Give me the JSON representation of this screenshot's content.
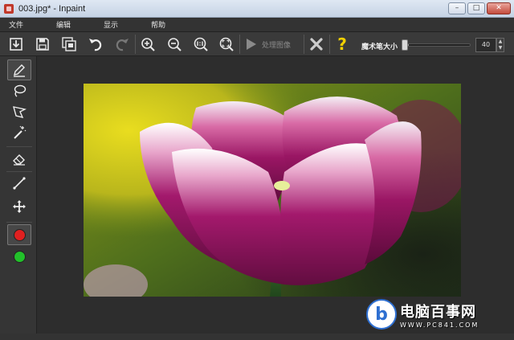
{
  "window": {
    "title": "003.jpg* - Inpaint",
    "minimize_glyph": "–",
    "maximize_glyph": "□",
    "close_glyph": "✕"
  },
  "menu": {
    "items": [
      {
        "label": "文件"
      },
      {
        "label": "编辑"
      },
      {
        "label": "显示"
      },
      {
        "label": "帮助"
      }
    ]
  },
  "toolbar": {
    "icons": [
      "open-icon",
      "save-icon",
      "save-as-icon",
      "undo-icon",
      "redo-icon",
      "zoom-in-icon",
      "zoom-out-icon",
      "actual-size-icon",
      "fit-window-icon"
    ],
    "process_label": "处理图像",
    "help_glyph": "?",
    "brush_size_label": "魔术笔大小",
    "brush_size_value": "40",
    "brush_size_fraction": 0.1,
    "spin_up": "▲",
    "spin_down": "▼"
  },
  "tools": {
    "icons": [
      "marker-icon",
      "lasso-icon",
      "polygon-lasso-icon",
      "magic-wand-icon",
      "eraser-icon",
      "line-icon",
      "move-icon"
    ],
    "colors": {
      "red": "#e02020",
      "green": "#22c02a"
    }
  },
  "watermark": {
    "logo_letter": "b",
    "title": "电脑百事网",
    "url": "WWW.PC841.COM"
  },
  "colors": {
    "background": "#2b2b2b",
    "accent_help": "#f2d000",
    "close_x": "#cccccc"
  }
}
